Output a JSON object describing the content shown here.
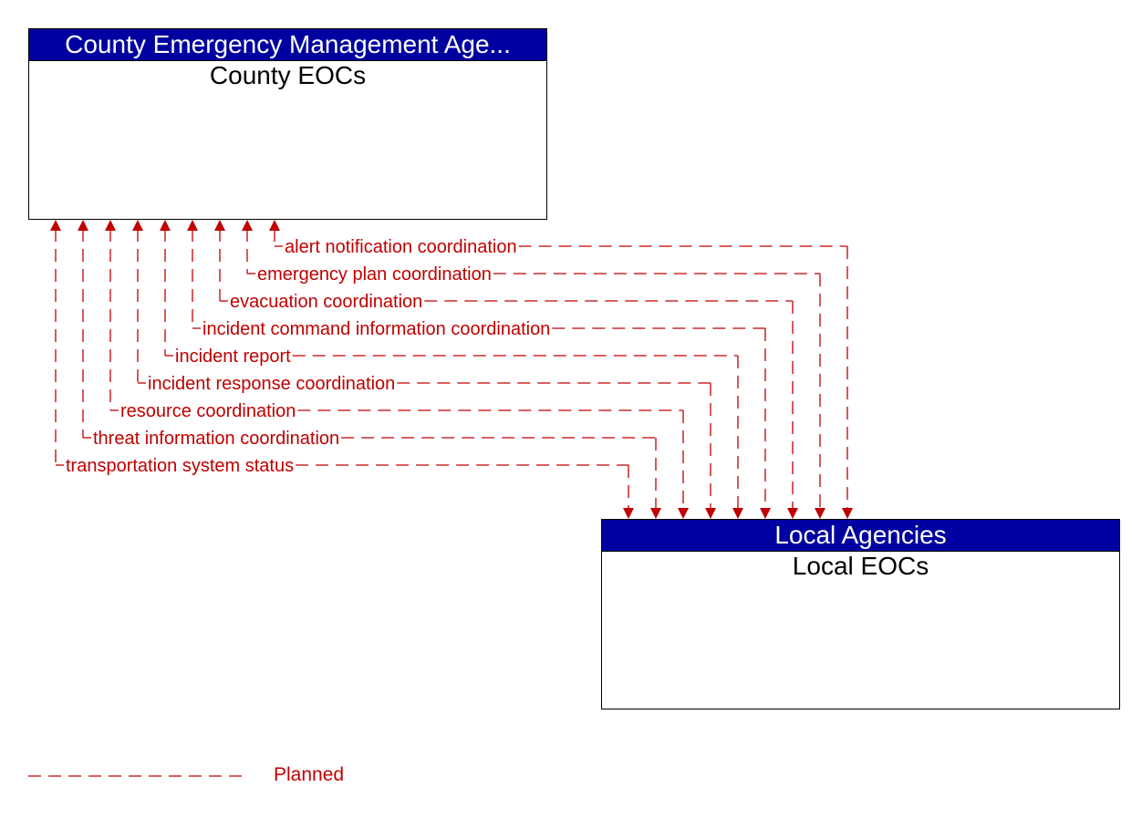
{
  "diagram": {
    "source": {
      "header": "County Emergency Management Age...",
      "title": "County EOCs"
    },
    "target": {
      "header": "Local Agencies",
      "title": "Local EOCs"
    },
    "flows": [
      {
        "label": "alert notification coordination",
        "status": "Planned",
        "direction": "bidirectional"
      },
      {
        "label": "emergency plan coordination",
        "status": "Planned",
        "direction": "bidirectional"
      },
      {
        "label": "evacuation coordination",
        "status": "Planned",
        "direction": "bidirectional"
      },
      {
        "label": "incident command information coordination",
        "status": "Planned",
        "direction": "bidirectional"
      },
      {
        "label": "incident report",
        "status": "Planned",
        "direction": "bidirectional"
      },
      {
        "label": "incident response coordination",
        "status": "Planned",
        "direction": "bidirectional"
      },
      {
        "label": "resource coordination",
        "status": "Planned",
        "direction": "bidirectional"
      },
      {
        "label": "threat information coordination",
        "status": "Planned",
        "direction": "bidirectional"
      },
      {
        "label": "transportation system status",
        "status": "Planned",
        "direction": "bidirectional"
      }
    ],
    "legend": {
      "label": "Planned",
      "line_style": "dashed",
      "color": "#c00000"
    },
    "colors": {
      "header_bg": "#0000a0",
      "flow": "#c00000"
    }
  }
}
